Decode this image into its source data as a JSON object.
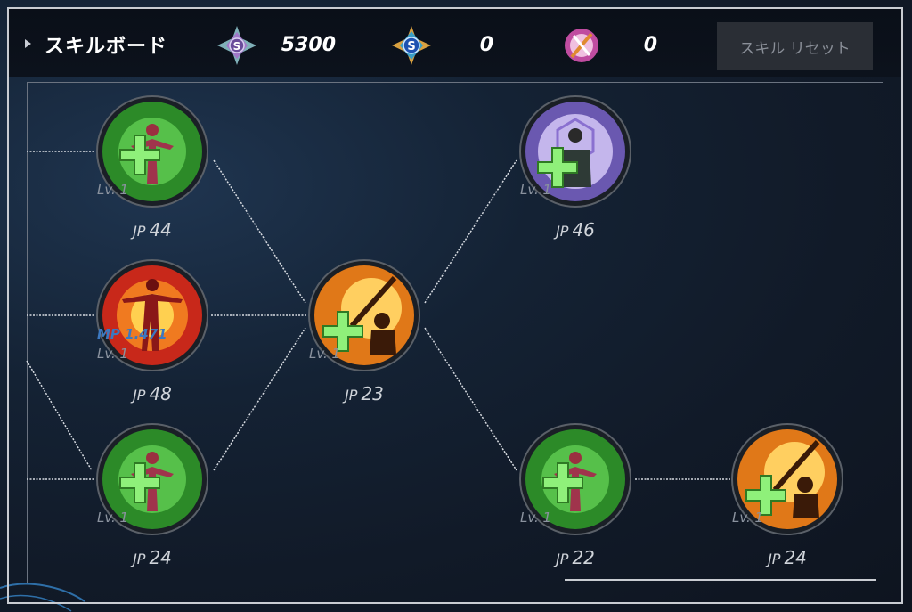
{
  "header": {
    "title": "スキルボード",
    "currencies": [
      {
        "icon": "silver-s-gem-icon",
        "value": "5300"
      },
      {
        "icon": "blue-s-gem-icon",
        "value": "0"
      },
      {
        "icon": "pink-emblem-icon",
        "value": "0"
      }
    ],
    "reset_label": "スキル リセット"
  },
  "board": {
    "jp_label": "JP",
    "nodes": [
      {
        "id": "n1",
        "icon": "green-heal-icon",
        "level": "Lv. 1",
        "jp": "44"
      },
      {
        "id": "n2",
        "icon": "red-burst-figure-icon",
        "level": "Lv. 1",
        "mp": "MP 1.471",
        "jp": "48"
      },
      {
        "id": "n3",
        "icon": "green-heal-icon",
        "level": "Lv. 1",
        "jp": "24"
      },
      {
        "id": "n4",
        "icon": "orange-sword-heal-icon",
        "level": "Lv. 1",
        "jp": "23"
      },
      {
        "id": "n5",
        "icon": "purple-shield-heal-icon",
        "level": "Lv. 1",
        "jp": "46"
      },
      {
        "id": "n6",
        "icon": "green-heal-icon",
        "level": "Lv. 1",
        "jp": "22"
      },
      {
        "id": "n7",
        "icon": "orange-sword-heal-icon",
        "level": "Lv. 1",
        "jp": "24"
      }
    ]
  },
  "colors": {
    "background": "#0e1522",
    "green_skill": "#3fae36",
    "orange_skill": "#f0a020",
    "purple_skill": "#a58fd8",
    "red_skill": "#e0301a"
  }
}
